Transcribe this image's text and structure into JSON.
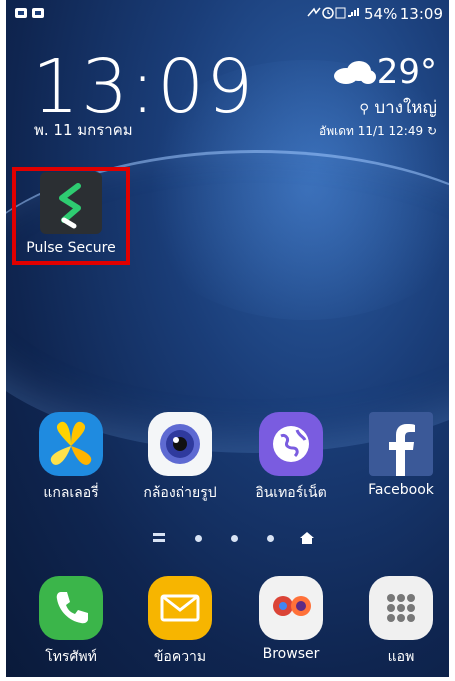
{
  "status_bar": {
    "left_icons": "✆ ✆",
    "right_icons": "✈⏰ VoLTE ≡ .∣",
    "battery": "54%",
    "time": "13:09"
  },
  "clock_widget": {
    "time": "13:09",
    "date": "พ. 11 มกราคม",
    "temperature": "29°",
    "location": "บางใหญ่",
    "updated": "อัพเดท 11/1 12:49"
  },
  "highlighted_app": {
    "label": "Pulse Secure"
  },
  "apps_row": [
    {
      "label": "แกลเลอรี่",
      "icon": "gallery-icon"
    },
    {
      "label": "กล้องถ่ายรูป",
      "icon": "camera-icon"
    },
    {
      "label": "อินเทอร์เน็ต",
      "icon": "internet-icon"
    },
    {
      "label": "Facebook",
      "icon": "facebook-icon"
    }
  ],
  "dock": [
    {
      "label": "โทรศัพท์",
      "icon": "phone-icon"
    },
    {
      "label": "ข้อความ",
      "icon": "messages-icon"
    },
    {
      "label": "Browser",
      "icon": "browser-icon"
    },
    {
      "label": "แอพ",
      "icon": "apps-icon"
    }
  ],
  "page_indicator": {
    "count": 4,
    "active": "home"
  },
  "colors": {
    "highlight": "#e10000",
    "facebook": "#3b5998"
  }
}
